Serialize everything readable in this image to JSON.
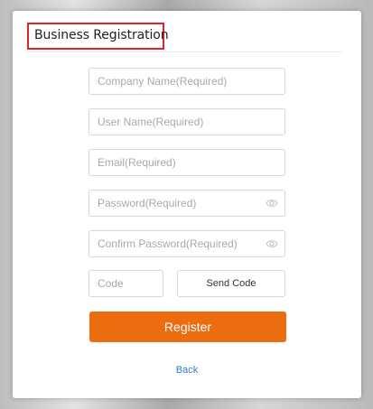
{
  "dialog": {
    "title": "Business Registration"
  },
  "form": {
    "company_name_placeholder": "Company Name(Required)",
    "user_name_placeholder": "User Name(Required)",
    "email_placeholder": "Email(Required)",
    "password_placeholder": "Password(Required)",
    "confirm_password_placeholder": "Confirm Password(Required)",
    "code_placeholder": "Code",
    "send_code_label": "Send Code",
    "register_label": "Register",
    "back_label": "Back"
  },
  "icons": {
    "password_toggle": "eye-icon",
    "confirm_password_toggle": "eye-icon"
  },
  "colors": {
    "accent": "#ec6c10",
    "highlight_border": "#d9232e",
    "link": "#2c7bd6"
  }
}
